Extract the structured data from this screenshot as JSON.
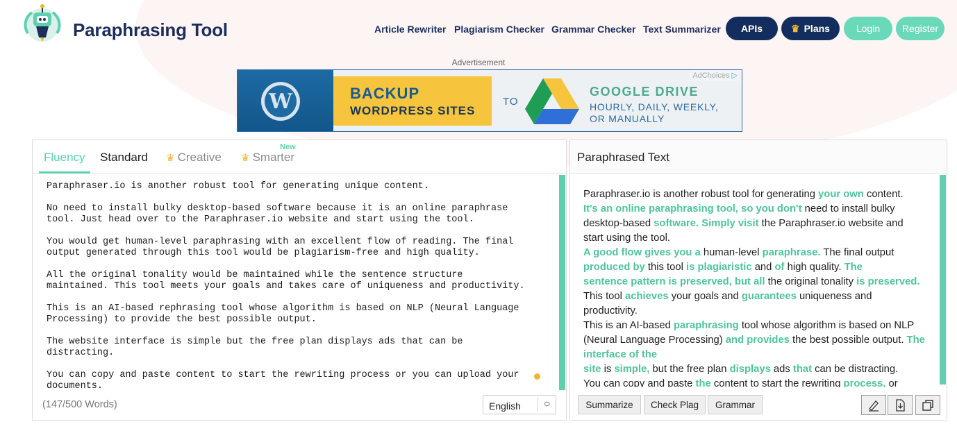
{
  "brand": {
    "name": "Paraphrasing Tool"
  },
  "nav": {
    "links": [
      "Article Rewriter",
      "Plagiarism Checker",
      "Grammar Checker",
      "Text Summarizer"
    ],
    "apis": "APIs",
    "plans": "Plans",
    "login": "Login",
    "register": "Register"
  },
  "ad": {
    "label": "Advertisement",
    "line1": "BACKUP",
    "line2": "WORDPRESS SITES",
    "to": "TO",
    "drive": "GOOGLE DRIVE",
    "sub1": "HOURLY, DAILY, WEEKLY,",
    "sub2": "OR MANUALLY",
    "choices": "AdChoices"
  },
  "input": {
    "tabs": [
      "Fluency",
      "Standard",
      "Creative",
      "Smarter"
    ],
    "new_badge": "New",
    "paragraphs": [
      "Paraphraser.io is another robust tool for generating unique content.",
      "No need to install bulky desktop-based software because it is an online paraphrase\ntool. Just head over to the Paraphraser.io website and start using the tool.",
      "You would get human-level paraphrasing with an excellent flow of reading. The final\noutput generated through this tool would be plagiarism-free and high quality.",
      "All the original tonality would be maintained while the sentence structure\nmaintained. This tool meets your goals and takes care of uniqueness and productivity.",
      "This is an AI-based rephrasing tool whose algorithm is based on NLP (Neural Language\nProcessing) to provide the best possible output.",
      "The website interface is simple but the free plan displays ads that can be\ndistracting.",
      "You can copy and paste content to start the rewriting process or you can upload your\ndocuments."
    ],
    "word_count": "(147/500 Words)",
    "language": "English"
  },
  "output": {
    "title": "Paraphrased Text",
    "segments": [
      {
        "t": "Paraphraser.io is another robust tool for generating ",
        "h": false
      },
      {
        "t": "your own",
        "h": true
      },
      {
        "t": " content.",
        "h": false
      },
      {
        "br": true
      },
      {
        "t": " It's an online paraphrasing tool, so you don't",
        "h": true
      },
      {
        "t": " need to install bulky desktop-based ",
        "h": false
      },
      {
        "t": "software. Simply visit",
        "h": true
      },
      {
        "t": " the Paraphraser.io website and start using the tool.",
        "h": false
      },
      {
        "br": true
      },
      {
        "t": " A good flow gives you a",
        "h": true
      },
      {
        "t": " human-level ",
        "h": false
      },
      {
        "t": "paraphrase.",
        "h": true
      },
      {
        "t": " The final output ",
        "h": false
      },
      {
        "t": "produced by",
        "h": true
      },
      {
        "t": " this tool ",
        "h": false
      },
      {
        "t": "is plagiaristic",
        "h": true
      },
      {
        "t": " and ",
        "h": false
      },
      {
        "t": "of",
        "h": true
      },
      {
        "t": " high quality. ",
        "h": false
      },
      {
        "t": "The",
        "h": true
      },
      {
        "br": true
      },
      {
        "t": " sentence pattern is preserved, but all",
        "h": true
      },
      {
        "t": " the original tonality ",
        "h": false
      },
      {
        "t": "is preserved.",
        "h": true
      },
      {
        "t": " This tool ",
        "h": false
      },
      {
        "t": "achieves",
        "h": true
      },
      {
        "t": " your goals and ",
        "h": false
      },
      {
        "t": "guarantees",
        "h": true
      },
      {
        "t": " uniqueness and productivity.",
        "h": false
      },
      {
        "br": true
      },
      {
        "t": " This is an AI-based ",
        "h": false
      },
      {
        "t": "paraphrasing",
        "h": true
      },
      {
        "t": " tool whose algorithm is based on NLP (Neural Language Processing) ",
        "h": false
      },
      {
        "t": "and provides",
        "h": true
      },
      {
        "t": " the best possible output. ",
        "h": false
      },
      {
        "t": "The interface of the",
        "h": true
      },
      {
        "br": true
      },
      {
        "t": " site",
        "h": true
      },
      {
        "t": " is ",
        "h": false
      },
      {
        "t": "simple,",
        "h": true
      },
      {
        "t": " but the free plan ",
        "h": false
      },
      {
        "t": "displays",
        "h": true
      },
      {
        "t": " ads ",
        "h": false
      },
      {
        "t": "that",
        "h": true
      },
      {
        "t": " can be distracting.",
        "h": false
      },
      {
        "br": true
      },
      {
        "t": " You can copy and paste ",
        "h": false
      },
      {
        "t": "the",
        "h": true
      },
      {
        "t": " content to start the rewriting ",
        "h": false
      },
      {
        "t": "process,",
        "h": true
      },
      {
        "t": " or",
        "h": false
      }
    ],
    "buttons": [
      "Summarize",
      "Check Plag",
      "Grammar"
    ],
    "icons": [
      "eraser-icon",
      "download-icon",
      "copy-icon"
    ]
  },
  "colors": {
    "accent": "#5fcfb0",
    "navy": "#132e5e",
    "green_pill": "#6ad9b9",
    "crown": "#f2b531"
  }
}
